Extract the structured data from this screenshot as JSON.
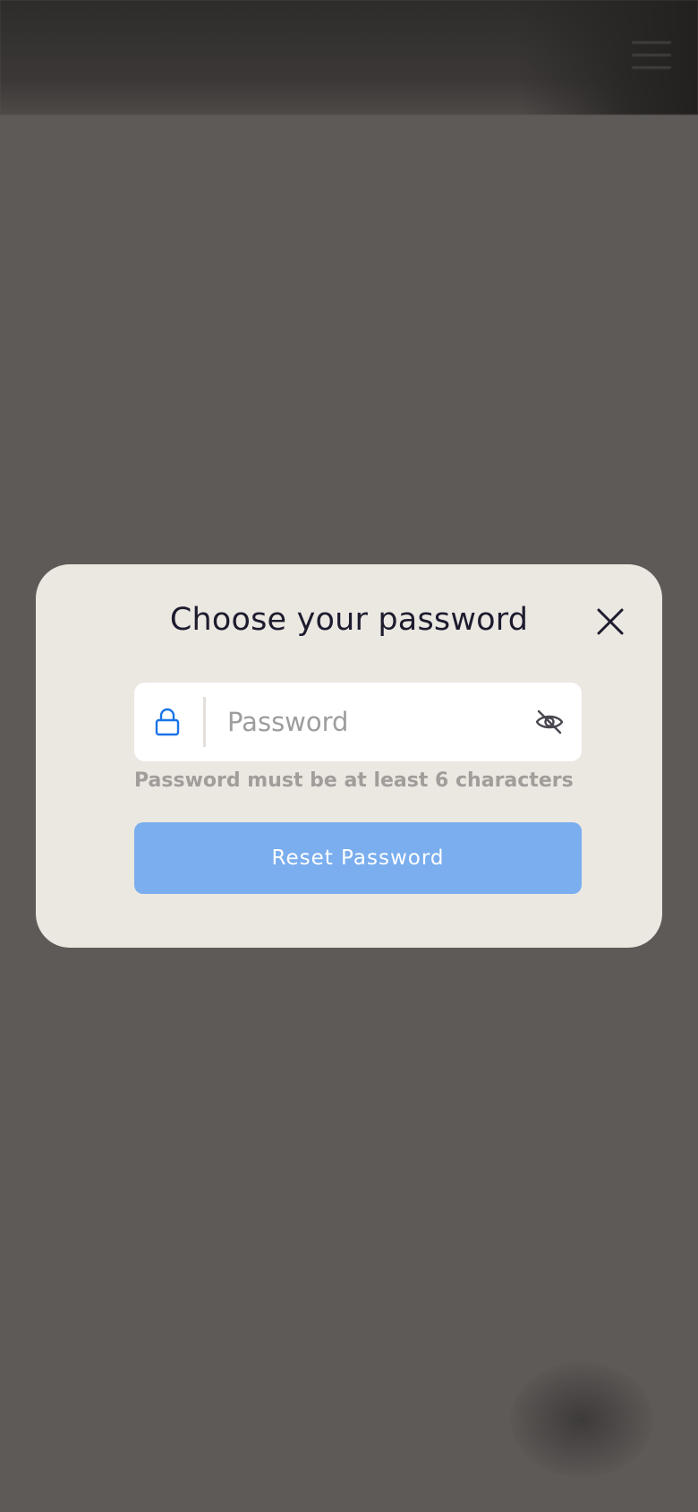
{
  "background": {
    "menu_icon": "hamburger-menu-icon"
  },
  "modal": {
    "title": "Choose your password",
    "close_icon": "close-icon",
    "password_field": {
      "placeholder": "Password",
      "value": "",
      "left_icon": "lock-icon",
      "right_icon": "eye-off-icon"
    },
    "hint": "Password must be at least 6 characters",
    "submit_label": "Reset Password"
  },
  "colors": {
    "accent": "#1a73e8",
    "button_disabled": "#7aaeee",
    "modal_bg": "#ebe7e1",
    "overlay": "#5e5a58",
    "title": "#1d1b2e",
    "hint": "#a09d9a"
  }
}
